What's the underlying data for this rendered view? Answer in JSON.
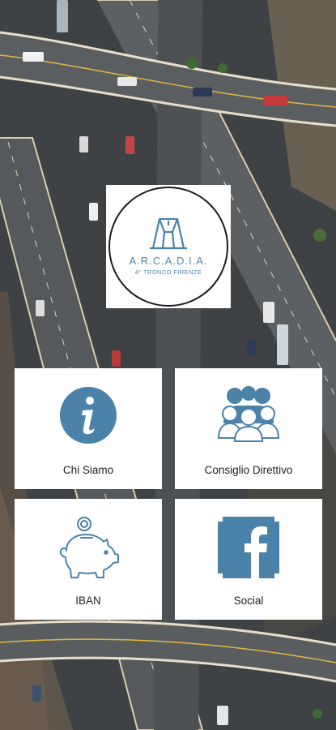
{
  "app": {
    "logo": {
      "title": "A.R.C.A.D.I.A.",
      "subtitle": "4° TRONCO FIRENZE"
    },
    "accent_color": "#4a82a9",
    "menu": [
      {
        "label": "Chi Siamo",
        "icon": "info-icon"
      },
      {
        "label": "Consiglio Direttivo",
        "icon": "people-group-icon"
      },
      {
        "label": "IBAN",
        "icon": "piggy-bank-icon"
      },
      {
        "label": "Social",
        "icon": "facebook-icon"
      }
    ]
  }
}
